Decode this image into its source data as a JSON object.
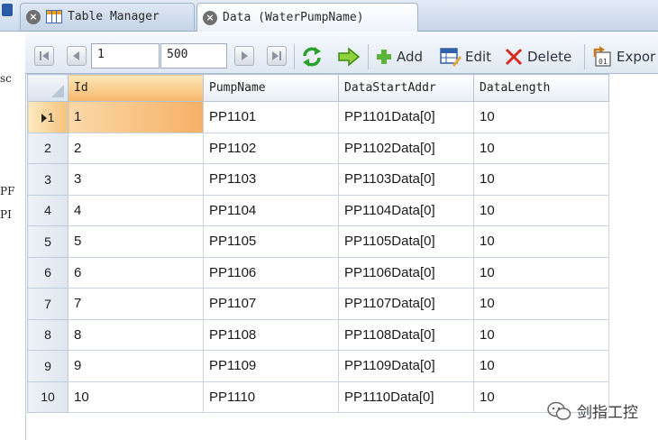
{
  "left_panel": {
    "fragments": [
      "sc",
      "PF",
      "PI"
    ]
  },
  "tabs": [
    {
      "label": "Table Manager",
      "active": false,
      "icon": "table-icon"
    },
    {
      "label": "Data (WaterPumpName)",
      "active": true,
      "icon": "none"
    }
  ],
  "toolbar": {
    "page_current": "1",
    "page_size": "500",
    "add_label": "Add",
    "edit_label": "Edit",
    "delete_label": "Delete",
    "export_label": "Expor",
    "icons": [
      "first-page-icon",
      "prev-page-icon",
      "next-page-icon",
      "last-page-icon",
      "refresh-icon",
      "go-arrow-icon",
      "add-icon",
      "edit-icon",
      "delete-icon",
      "export-icon"
    ]
  },
  "grid": {
    "columns": [
      "Id",
      "PumpName",
      "DataStartAddr",
      "DataLength"
    ],
    "sorted_column": "Id",
    "current_row": 1,
    "rows": [
      {
        "num": "1",
        "id": "1",
        "name": "PP1101",
        "addr": "PP1101Data[0]",
        "len": "10"
      },
      {
        "num": "2",
        "id": "2",
        "name": "PP1102",
        "addr": "PP1102Data[0]",
        "len": "10"
      },
      {
        "num": "3",
        "id": "3",
        "name": "PP1103",
        "addr": "PP1103Data[0]",
        "len": "10"
      },
      {
        "num": "4",
        "id": "4",
        "name": "PP1104",
        "addr": "PP1104Data[0]",
        "len": "10"
      },
      {
        "num": "5",
        "id": "5",
        "name": "PP1105",
        "addr": "PP1105Data[0]",
        "len": "10"
      },
      {
        "num": "6",
        "id": "6",
        "name": "PP1106",
        "addr": "PP1106Data[0]",
        "len": "10"
      },
      {
        "num": "7",
        "id": "7",
        "name": "PP1107",
        "addr": "PP1107Data[0]",
        "len": "10"
      },
      {
        "num": "8",
        "id": "8",
        "name": "PP1108",
        "addr": "PP1108Data[0]",
        "len": "10"
      },
      {
        "num": "9",
        "id": "9",
        "name": "PP1109",
        "addr": "PP1109Data[0]",
        "len": "10"
      },
      {
        "num": "10",
        "id": "10",
        "name": "PP1110",
        "addr": "PP1110Data[0]",
        "len": "10"
      }
    ]
  },
  "watermark": {
    "text": "剑指工控",
    "icon": "wechat-icon"
  },
  "colors": {
    "accent_sorted": "#f6b86c",
    "toolbar_bg": "#dfe8f3",
    "grid_border": "#c9d4e2"
  }
}
